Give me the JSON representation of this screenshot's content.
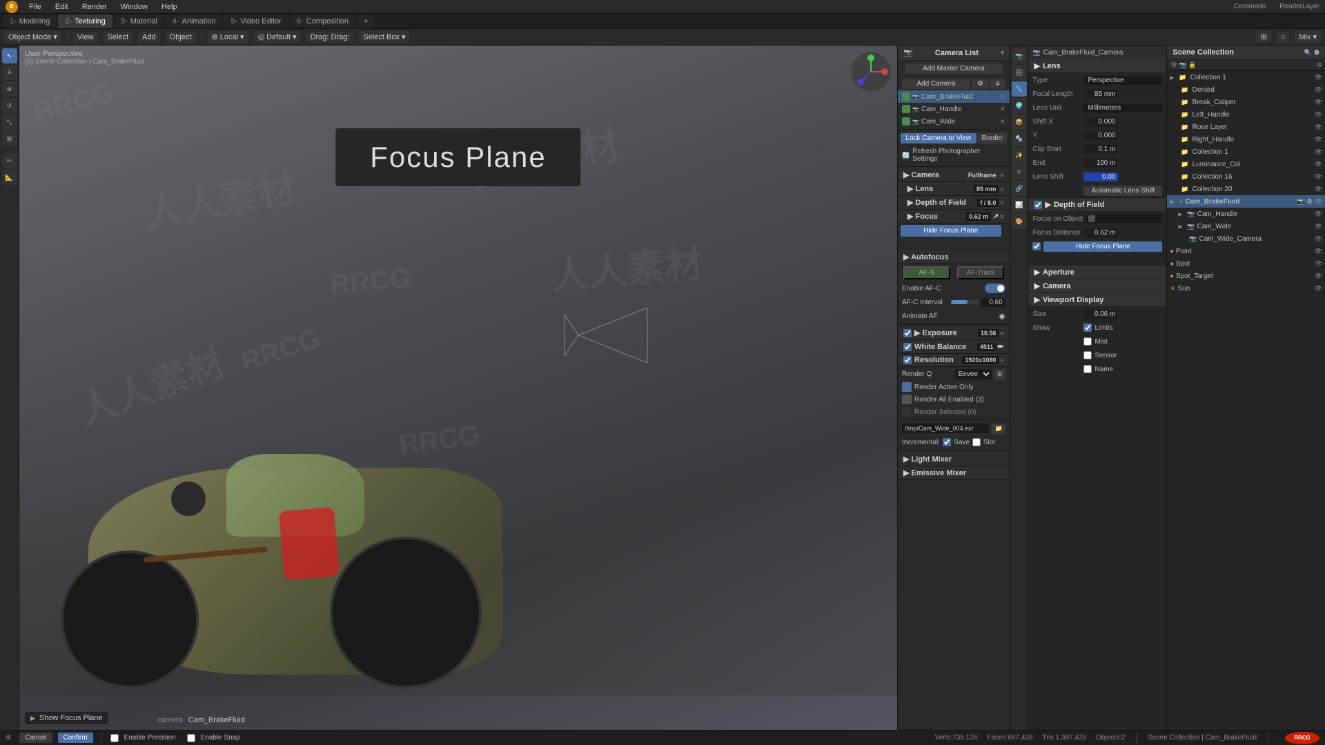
{
  "app": {
    "title": "Blender",
    "menu": [
      "File",
      "Edit",
      "Render",
      "Window",
      "Help"
    ]
  },
  "workspace_tabs": [
    {
      "num": "1-",
      "label": "Modeling"
    },
    {
      "num": "2-",
      "label": "Texturing"
    },
    {
      "num": "3-",
      "label": "Material"
    },
    {
      "num": "4-",
      "label": "Animation"
    },
    {
      "num": "5-",
      "label": "Video Editor"
    },
    {
      "num": "6-",
      "label": "Composition"
    },
    {
      "num": "+",
      "label": ""
    }
  ],
  "toolbar": {
    "mode": "Object Mode",
    "view": "View",
    "select": "Select",
    "add": "Add",
    "object": "Object",
    "orientation": "Local",
    "pivot": "Default",
    "drag": "Drag:",
    "select_box": "Select Box",
    "snap_label": "Mix"
  },
  "viewport": {
    "info": "User Perspective",
    "collection_path": "(0) Scene Collection | Cam_BrakeFluid",
    "focus_plane_text": "Focus Plane",
    "show_focus_label": "Show Focus Plane",
    "camera_label": "camera",
    "camera_name": "Cam_BrakeFluid"
  },
  "camera_list": {
    "title": "Camera List",
    "add_master": "Add Master Camera",
    "add_camera": "Add Camera",
    "cameras": [
      {
        "name": "Cam_BrakeFluid",
        "active": true
      },
      {
        "name": "Cam_Handle",
        "active": false
      },
      {
        "name": "Cam_Wide",
        "active": false
      }
    ],
    "lock_camera": "Lock Camera to View",
    "border": "Border",
    "refresh": "Refresh Photographer Settings"
  },
  "camera_settings": {
    "camera_label": "Camera",
    "camera_type": "Fullframe",
    "lens_label": "Lens",
    "lens_value": "85 mm",
    "dof_label": "Depth of Field",
    "dof_value": "f / 8.0",
    "focus_label": "Focus",
    "focus_value": "0.62 m",
    "hide_focus": "Hide Focus Plane",
    "autofocus_label": "Autofocus",
    "af_s": "AF-S",
    "af_track": "AF-Track",
    "enable_afc": "Enable AF-C",
    "afc_interval": "AF-C Interval",
    "afc_value": "0.60",
    "animate_af": "Animate AF",
    "exposure_label": "Exposure",
    "exposure_value": "10.56",
    "white_balance": "White Balance",
    "wb_value": "4511",
    "resolution_label": "Resolution",
    "res_value": "1920x1080",
    "render_q_label": "Render Q",
    "render_q_value": "Eevee",
    "render_active": "Render Active Only",
    "render_all": "Render All Enabled (3)",
    "render_selected": "Render Selected (0)",
    "output_path": "/tmp/Cam_Wide_004.exr",
    "incremental": "Incremental:",
    "save": "Save",
    "slot": "Slot",
    "light_mixer": "Light Mixer",
    "emissive_mixer": "Emissive Mixer"
  },
  "props_panel": {
    "camera_header": "Cam_BrakeFluid_Camera",
    "lens_header": "Lens",
    "type_label": "Type",
    "type_value": "Perspective",
    "focal_label": "Focal Length",
    "focal_value": "85 mm",
    "lens_unit": "Lens Unit",
    "lens_unit_value": "Millimeters",
    "shift_x": "Shift X",
    "shift_x_val": "0.000",
    "shift_y": "Y",
    "shift_y_val": "0.000",
    "clip_start": "Clip Start",
    "clip_start_val": "0.1 m",
    "clip_end": "End",
    "clip_end_val": "100 m",
    "lens_shift": "Lens Shift",
    "lens_shift_val": "0.00",
    "auto_lens_shift": "Automatic Lens Shift",
    "dof_header": "Depth of Field",
    "focus_on_obj": "Focus on Object",
    "focus_distance": "Focus Distance",
    "focus_dist_val": "0.62 m",
    "hide_focus_btn": "Hide Focus Plane",
    "aperture": "Aperture",
    "camera_section": "Camera",
    "viewport_display": "Viewport Display",
    "size_label": "Size",
    "size_val": "0.06 m",
    "show_label": "Show",
    "limits": "Limits",
    "mist": "Mist",
    "sensor": "Sensor",
    "name_label": "Name"
  },
  "scene_collection": {
    "title": "Scene Collection",
    "collections": [
      {
        "name": "Collection 1",
        "level": 0
      },
      {
        "name": "Dented",
        "level": 1
      },
      {
        "name": "Break_Caliper",
        "level": 1
      },
      {
        "name": "Left_Handle",
        "level": 1
      },
      {
        "name": "Rose Layer",
        "level": 1
      },
      {
        "name": "Right_Handle",
        "level": 1
      },
      {
        "name": "Collection 1",
        "level": 1
      },
      {
        "name": "Luminance_Col",
        "level": 1
      },
      {
        "name": "Collection 16",
        "level": 1
      },
      {
        "name": "Collection 20",
        "level": 1
      },
      {
        "name": "Cam_BrakeFluid",
        "level": 0,
        "active": true
      },
      {
        "name": "Cam_Handle",
        "level": 1
      },
      {
        "name": "Cam_Wide",
        "level": 1
      },
      {
        "name": "Cam_Wide_Camera",
        "level": 2
      },
      {
        "name": "Point",
        "level": 1
      },
      {
        "name": "Spot",
        "level": 1
      },
      {
        "name": "Spot_Target",
        "level": 1
      },
      {
        "name": "Sun",
        "level": 1
      }
    ]
  },
  "status_bar": {
    "mode": "Object Mode",
    "view": "View",
    "select": "Select",
    "add": "Add",
    "object": "Object",
    "verts": "Verts:735,126",
    "faces": "Faces:697,428",
    "tris": "Tris:1,397,428",
    "objects": "Objects:2",
    "scene": "Scene Collection | Cam_BrakeFluid",
    "render_layer": "RenderLayer",
    "commodo": "Commodo"
  },
  "operator_bar": {
    "cancel": "Cancel",
    "confirm": "Confirm",
    "enable_precision": "Enable Precision",
    "enable_snap": "Enable Snap"
  }
}
